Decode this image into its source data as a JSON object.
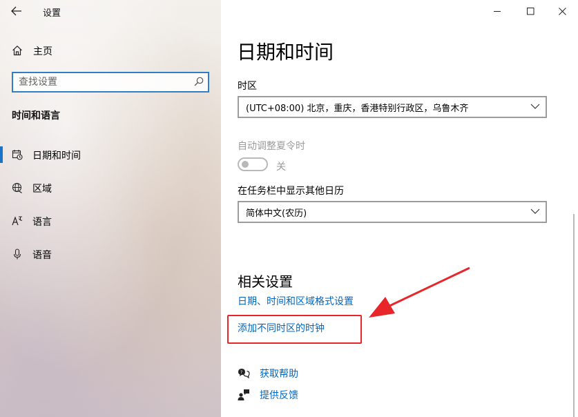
{
  "window": {
    "title": "设置"
  },
  "sidebar": {
    "home_label": "主页",
    "search_placeholder": "查找设置",
    "section_title": "时间和语言",
    "items": [
      {
        "label": "日期和时间",
        "icon": "calendar-clock-icon",
        "active": true
      },
      {
        "label": "区域",
        "icon": "globe-icon",
        "active": false
      },
      {
        "label": "语言",
        "icon": "language-icon",
        "active": false
      },
      {
        "label": "语音",
        "icon": "microphone-icon",
        "active": false
      }
    ]
  },
  "main": {
    "page_title": "日期和时间",
    "timezone_label": "时区",
    "timezone_value": "(UTC+08:00) 北京，重庆，香港特别行政区，乌鲁木齐",
    "dst_label": "自动调整夏令时",
    "dst_state": "关",
    "calendar_label": "在任务栏中显示其他日历",
    "calendar_value": "简体中文(农历)",
    "related_title": "相关设置",
    "related_links": [
      "日期、时间和区域格式设置",
      "添加不同时区的时钟"
    ],
    "help_label": "获取帮助",
    "feedback_label": "提供反馈"
  },
  "colors": {
    "accent": "#0067c0",
    "annotation": "#e8262a"
  }
}
